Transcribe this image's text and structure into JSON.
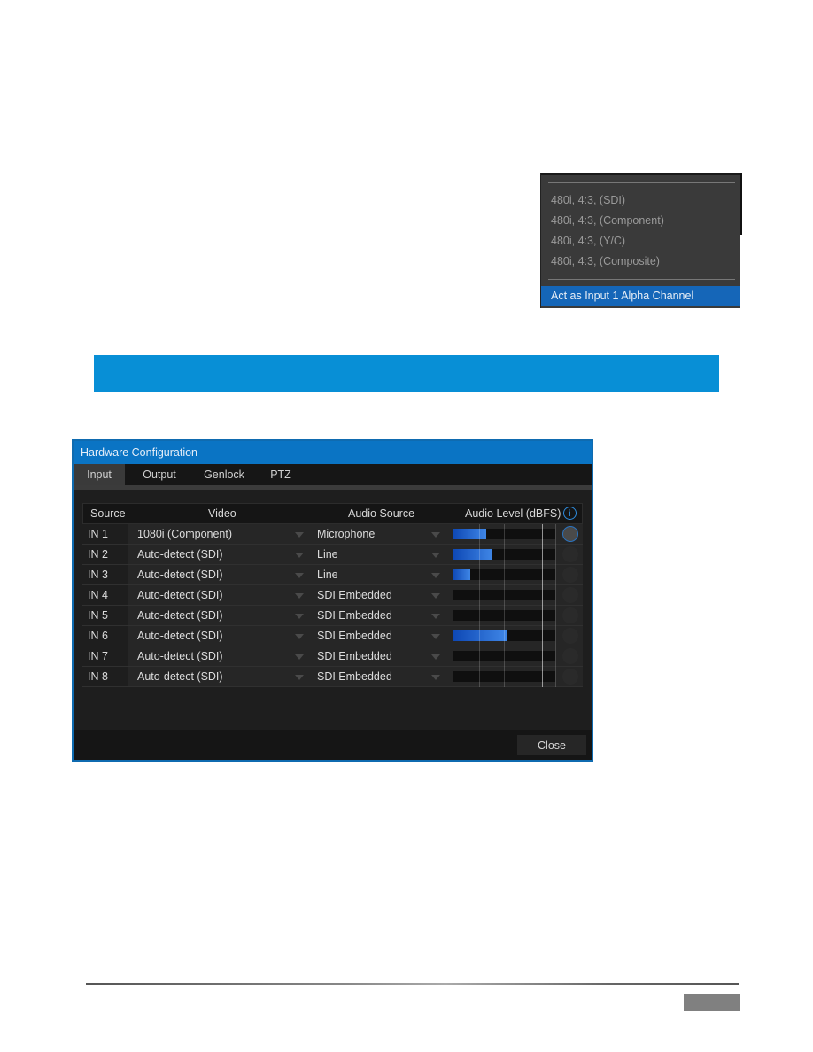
{
  "dropdown_menu": {
    "items": [
      "480i, 4:3, (SDI)",
      "480i, 4:3, (Component)",
      "480i, 4:3, (Y/C)",
      "480i, 4:3, (Composite)"
    ],
    "selected_item": "Act as Input 1 Alpha Channel"
  },
  "banner": {
    "color": "#088fd6"
  },
  "dialog": {
    "title": "Hardware Configuration",
    "tabs": [
      {
        "label": "Input",
        "active": true
      },
      {
        "label": "Output",
        "active": false
      },
      {
        "label": "Genlock",
        "active": false
      },
      {
        "label": "PTZ",
        "active": false
      }
    ],
    "columns": {
      "source": "Source",
      "video": "Video",
      "audio_source": "Audio Source",
      "audio_level": "Audio Level (dBFS)"
    },
    "rows": [
      {
        "source": "IN 1",
        "video": "1080i (Component)",
        "audio": "Microphone",
        "level_pct": 33,
        "knob_active": true
      },
      {
        "source": "IN 2",
        "video": "Auto-detect (SDI)",
        "audio": "Line",
        "level_pct": 39,
        "knob_active": false
      },
      {
        "source": "IN 3",
        "video": "Auto-detect (SDI)",
        "audio": "Line",
        "level_pct": 17,
        "knob_active": false
      },
      {
        "source": "IN 4",
        "video": "Auto-detect (SDI)",
        "audio": "SDI Embedded",
        "level_pct": 0,
        "knob_active": false
      },
      {
        "source": "IN 5",
        "video": "Auto-detect (SDI)",
        "audio": "SDI Embedded",
        "level_pct": 0,
        "knob_active": false
      },
      {
        "source": "IN 6",
        "video": "Auto-detect (SDI)",
        "audio": "SDI Embedded",
        "level_pct": 53,
        "knob_active": false
      },
      {
        "source": "IN 7",
        "video": "Auto-detect (SDI)",
        "audio": "SDI Embedded",
        "level_pct": 0,
        "knob_active": false
      },
      {
        "source": "IN 8",
        "video": "Auto-detect (SDI)",
        "audio": "SDI Embedded",
        "level_pct": 0,
        "knob_active": false
      }
    ],
    "close_label": "Close"
  }
}
